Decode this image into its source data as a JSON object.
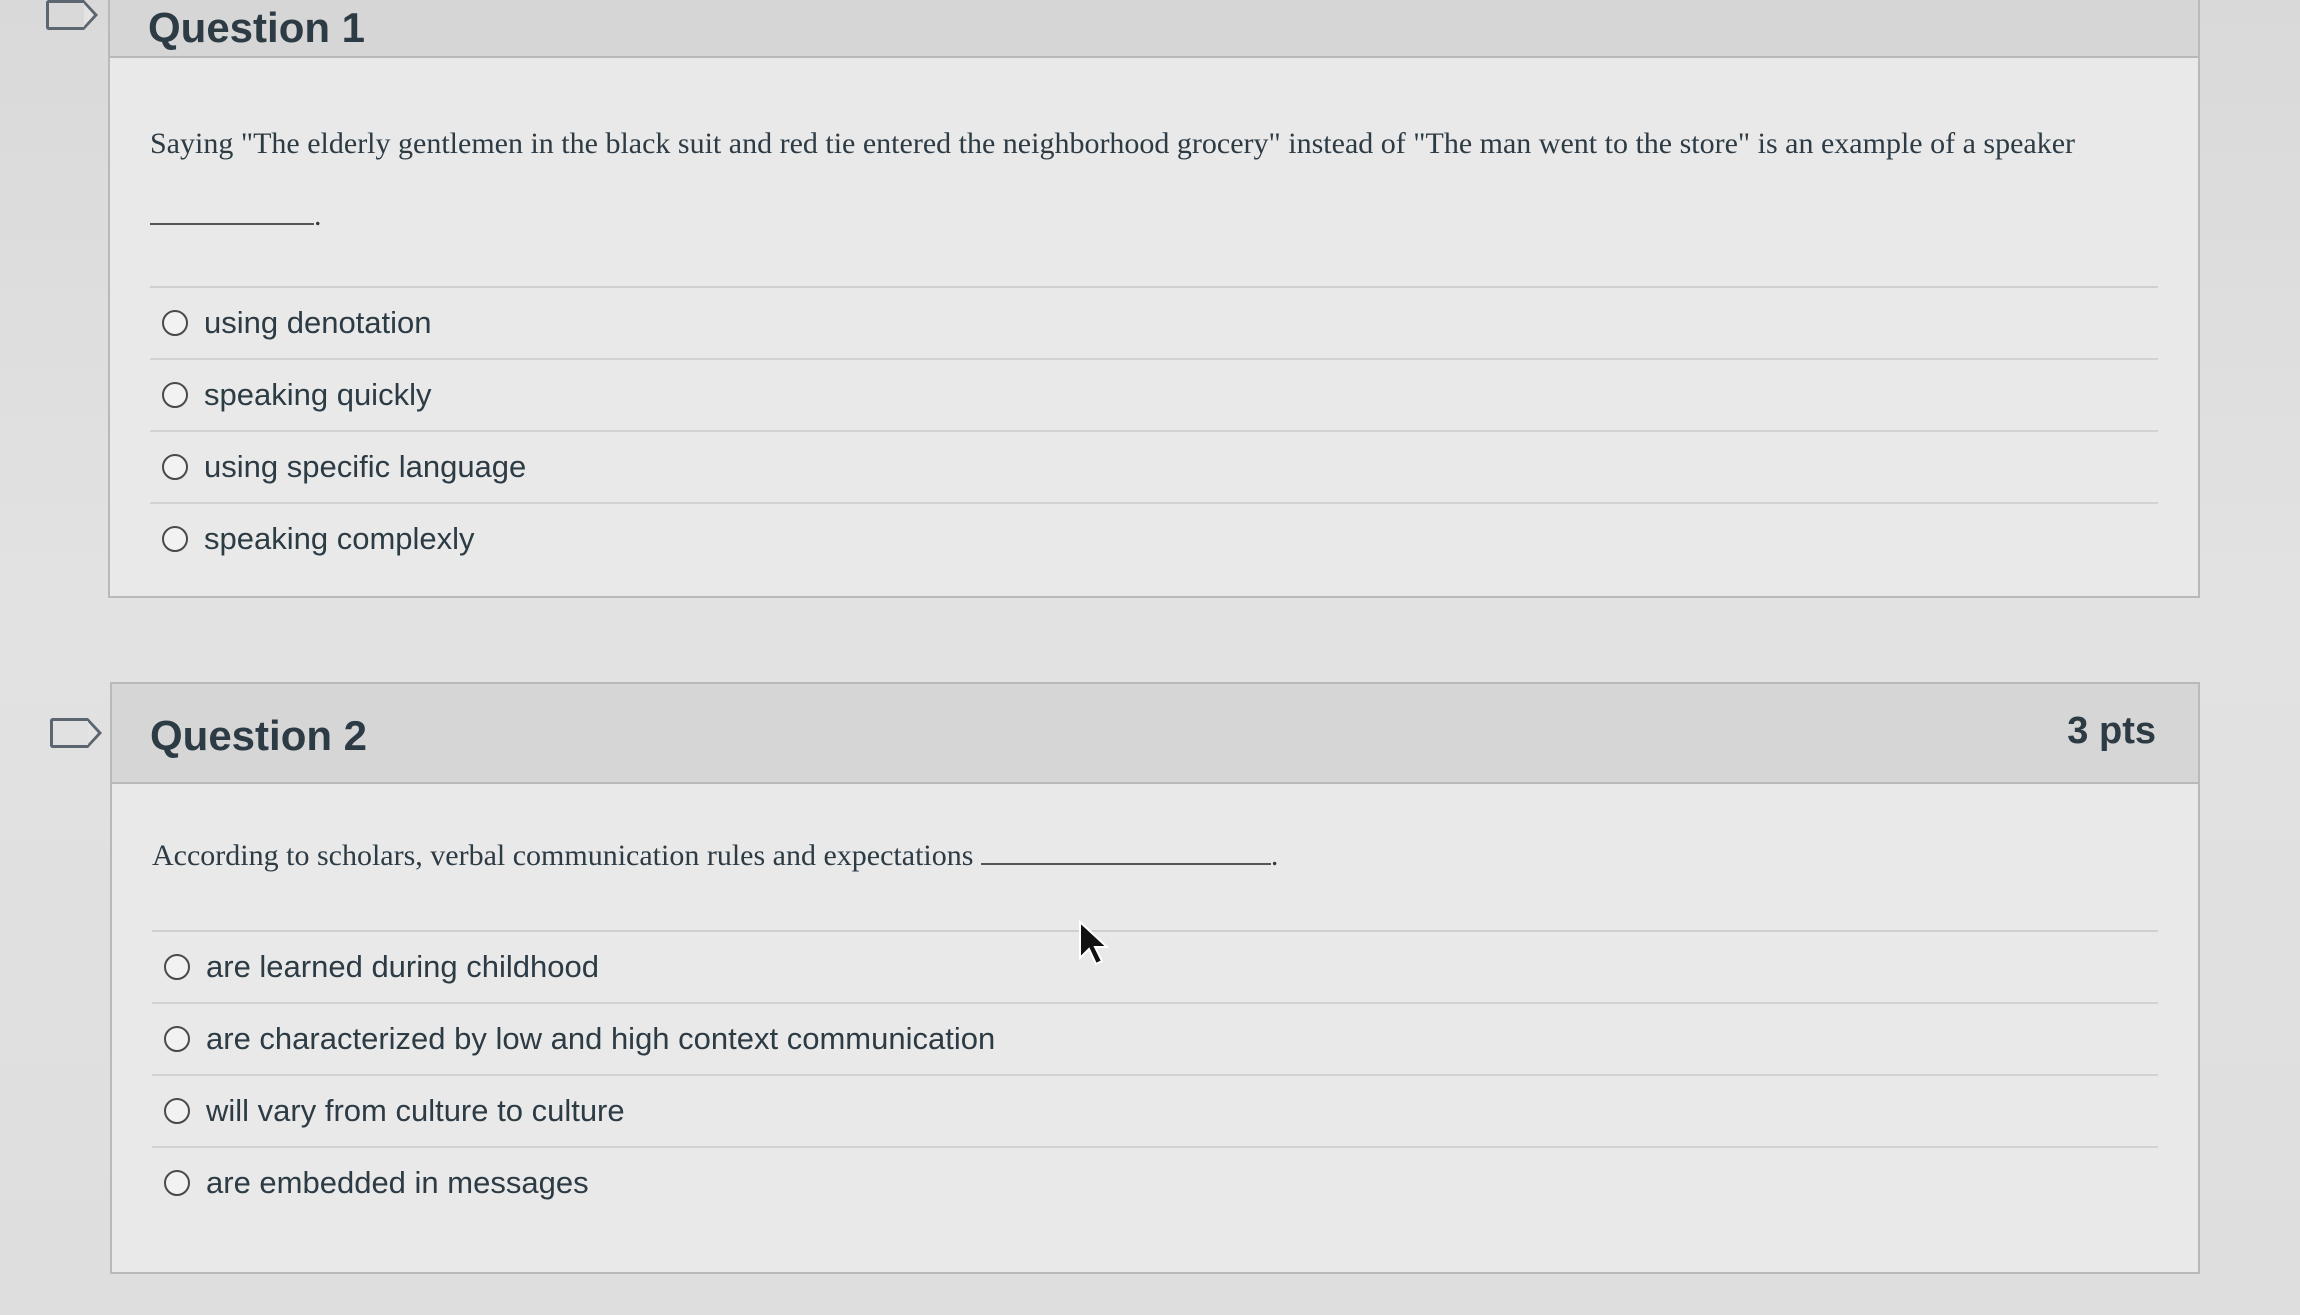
{
  "questions": [
    {
      "title": "Question 1",
      "text": "Saying \"The elderly gentlemen in the black suit and red tie entered the neighborhood grocery\" instead of \"The man went to the store\" is an example of a speaker",
      "answers": [
        "using denotation",
        "speaking quickly",
        "using specific language",
        "speaking complexly"
      ]
    },
    {
      "title": "Question 2",
      "points": "3 pts",
      "text": "According to scholars, verbal communication rules and expectations",
      "answers": [
        "are learned during childhood",
        "are characterized by low and high context communication",
        "will vary from culture to culture",
        "are embedded in messages"
      ]
    }
  ],
  "icons": {
    "flag": "flag-icon",
    "radio": "radio-button-icon",
    "cursor": "mouse-pointer-icon"
  }
}
